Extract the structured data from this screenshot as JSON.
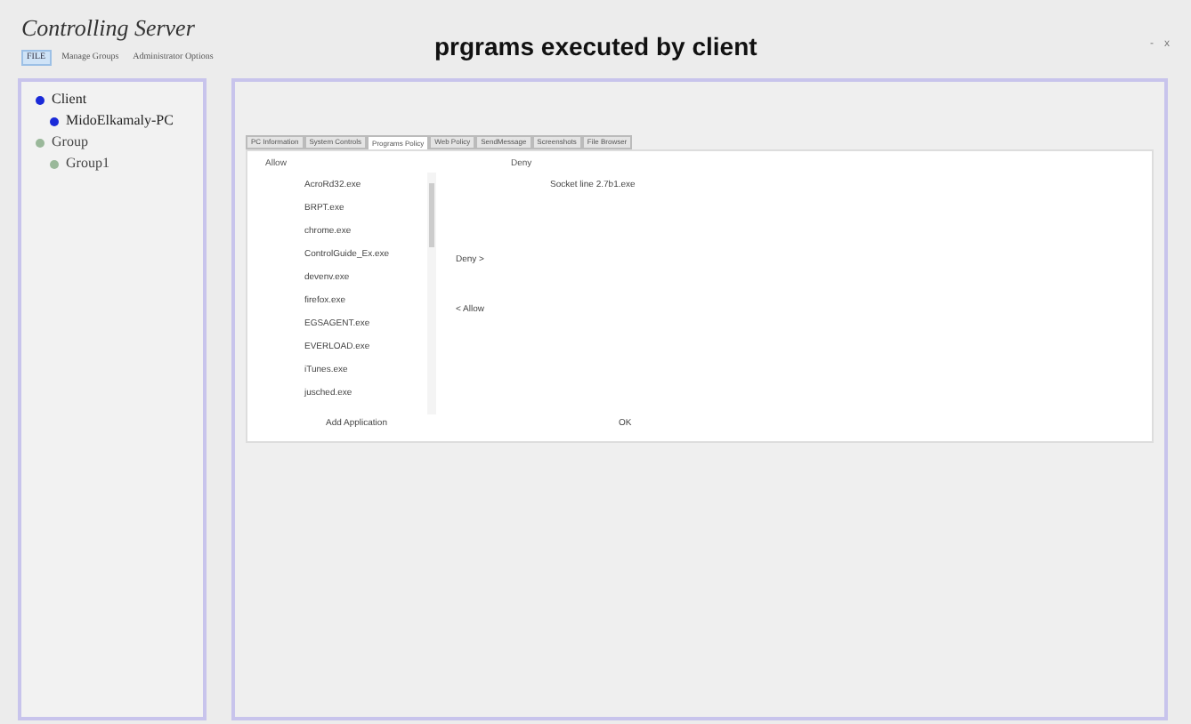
{
  "app_title": "Controlling Server",
  "window_controls": [
    "-",
    "x"
  ],
  "menu": [
    {
      "label": "FILE",
      "selected": true
    },
    {
      "label": "Manage Groups",
      "selected": false
    },
    {
      "label": "Administrator Options",
      "selected": false
    }
  ],
  "heading": "prgrams executed by client",
  "tree": [
    {
      "label": "Client",
      "kind": "client",
      "children": [
        {
          "label": "MidoElkamaly-PC",
          "kind": "client"
        }
      ]
    },
    {
      "label": "Group",
      "kind": "group",
      "children": [
        {
          "label": "Group1",
          "kind": "group"
        }
      ]
    }
  ],
  "tabs": [
    {
      "label": "PC Information",
      "selected": false
    },
    {
      "label": "System Controls",
      "selected": false
    },
    {
      "label": "Programs Policy",
      "selected": true
    },
    {
      "label": "Web Policy",
      "selected": false
    },
    {
      "label": "SendMessage",
      "selected": false
    },
    {
      "label": "Screenshots",
      "selected": false
    },
    {
      "label": "File Browser",
      "selected": false
    }
  ],
  "allow": {
    "label": "Allow",
    "items": [
      "AcroRd32.exe",
      "BRPT.exe",
      "chrome.exe",
      "ControlGuide_Ex.exe",
      "devenv.exe",
      "firefox.exe",
      "EGSAGENT.exe",
      "EVERLOAD.exe",
      "iTunes.exe",
      "jusched.exe"
    ]
  },
  "deny": {
    "label": "Deny",
    "items": [
      "Socket line 2.7b1.exe"
    ]
  },
  "deny_button": "Deny >",
  "allow_button": "< Allow",
  "add_button": "Add Application",
  "ok_button": "OK"
}
